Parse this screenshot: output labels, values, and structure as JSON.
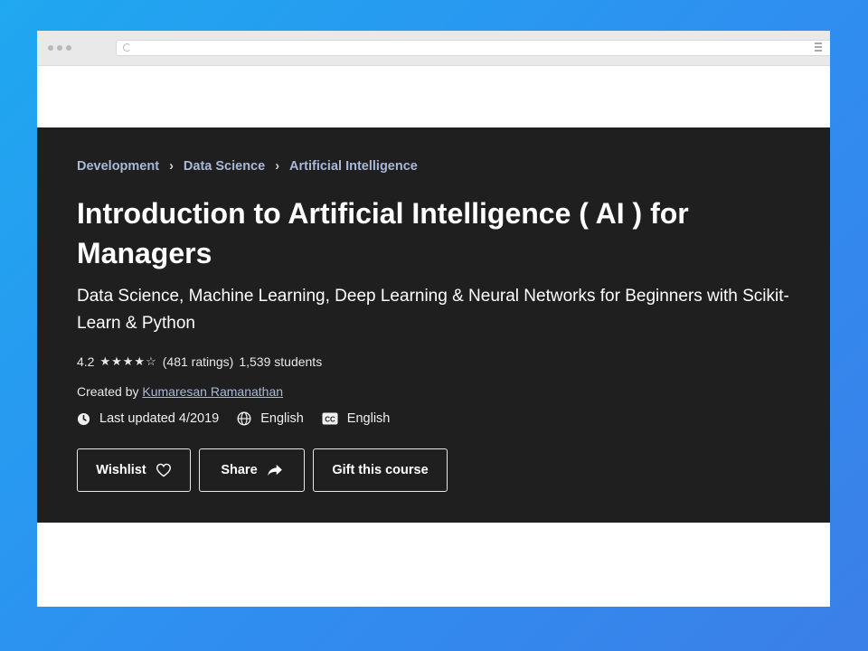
{
  "breadcrumb": [
    "Development",
    "Data Science",
    "Artificial Intelligence"
  ],
  "course": {
    "title": "Introduction to Artificial Intelligence ( AI ) for Managers",
    "subtitle": "Data Science, Machine Learning, Deep Learning & Neural Networks for Beginners with Scikit-Learn & Python",
    "rating": "4.2",
    "stars": "★★★★☆",
    "ratings_count": "(481 ratings)",
    "students": "1,539 students",
    "created_by_label": "Created by",
    "instructor": "Kumaresan Ramanathan",
    "last_updated": "Last updated 4/2019",
    "language": "English",
    "captions": "English"
  },
  "actions": {
    "wishlist": "Wishlist",
    "share": "Share",
    "gift": "Gift this course"
  },
  "icons": {
    "update": "update-icon",
    "language": "globe-icon",
    "captions": "cc-icon",
    "wishlist": "heart-icon",
    "share": "share-arrow-icon"
  },
  "colors": {
    "background_gradient_start": "#1fa8f0",
    "background_gradient_end": "#3b7fe8",
    "hero_bg": "#1f1f1f",
    "breadcrumb_link": "#a8b9d8"
  }
}
